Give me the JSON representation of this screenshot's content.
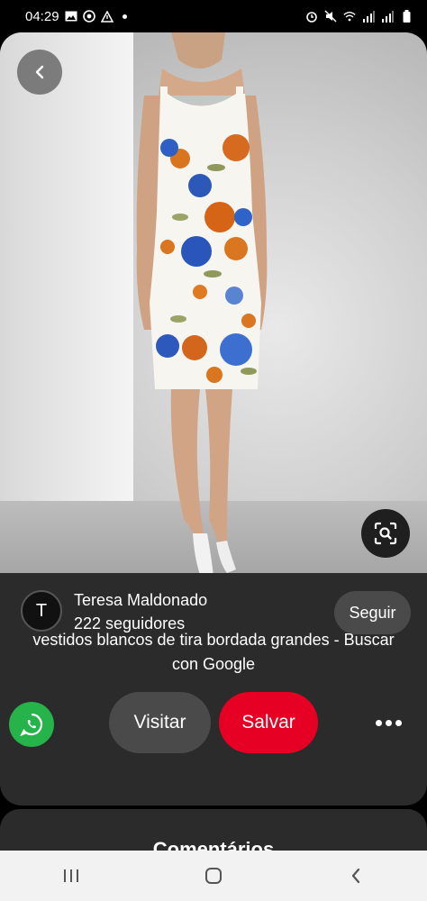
{
  "status_bar": {
    "time": "04:29",
    "left_icons": [
      "image-icon",
      "whatsapp-icon",
      "alert-icon"
    ],
    "right_icons": [
      "alarm-icon",
      "mute-icon",
      "wifi-icon",
      "signal-icon",
      "signal-icon",
      "battery-icon"
    ]
  },
  "pin": {
    "image_subject": "floral-dress-photo",
    "creator": {
      "initial": "T",
      "name": "Teresa Maldonado",
      "followers": "222 seguidores",
      "follow_label": "Seguir"
    },
    "title": "vestidos blancos de tira bordada grandes - Buscar con Google"
  },
  "actions": {
    "visit_label": "Visitar",
    "save_label": "Salvar"
  },
  "comments": {
    "title": "Comentários"
  },
  "colors": {
    "save": "#e60023",
    "whatsapp": "#25b34a",
    "card": "#2b2b2b"
  }
}
